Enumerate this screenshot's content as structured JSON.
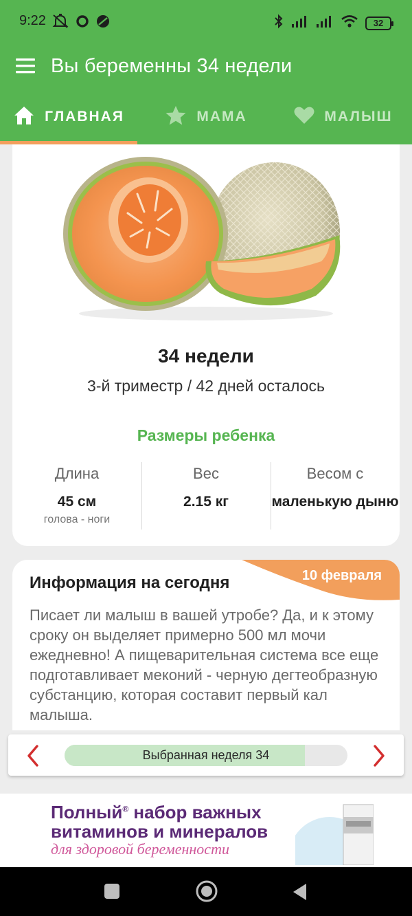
{
  "status_bar": {
    "time": "9:22",
    "battery": "32"
  },
  "app_bar": {
    "title": "Вы беременны 34 недели",
    "menu_icon": "hamburger-menu-icon"
  },
  "tabs": [
    {
      "label": "ГЛАВНАЯ",
      "icon": "home-icon",
      "active": true
    },
    {
      "label": "МАМА",
      "icon": "star-icon",
      "active": false
    },
    {
      "label": "МАЛЫШ",
      "icon": "heart-icon",
      "active": false
    }
  ],
  "week_card": {
    "fruit_icon": "cantaloupe-melon-image",
    "week_title": "34 недели",
    "trimester_text": "3-й триместр / 42 дней осталось",
    "sizes_title": "Размеры ребенка",
    "stats": [
      {
        "label": "Длина",
        "value": "45 см",
        "note": "голова - ноги"
      },
      {
        "label": "Вес",
        "value": "2.15 кг",
        "note": ""
      },
      {
        "label": "Весом с",
        "value": "маленькую дыню",
        "note": ""
      }
    ]
  },
  "info_card": {
    "date": "10 февраля",
    "title": "Информация на сегодня",
    "body": "Писает ли малыш в вашей утробе? Да, и к этому сроку он выделяет примерно 500 мл мочи ежедневно! А пищеварительная система все еще подготавливает меконий - черную дегтеобразную субстанцию, которая составит первый кал малыша."
  },
  "week_selector": {
    "label": "Выбранная неделя 34",
    "selected_week": 34,
    "progress_fraction": 0.85,
    "prev_icon": "chevron-left-icon",
    "next_icon": "chevron-right-icon"
  },
  "ad_banner": {
    "line1": "Полный набор важных",
    "line2": "витаминов и минералов",
    "line3": "для здоровой беременности",
    "registered_mark": "®"
  },
  "colors": {
    "primary_green": "#56b551",
    "accent_orange": "#f29f5c",
    "selector_fill": "#c8e7c7"
  }
}
